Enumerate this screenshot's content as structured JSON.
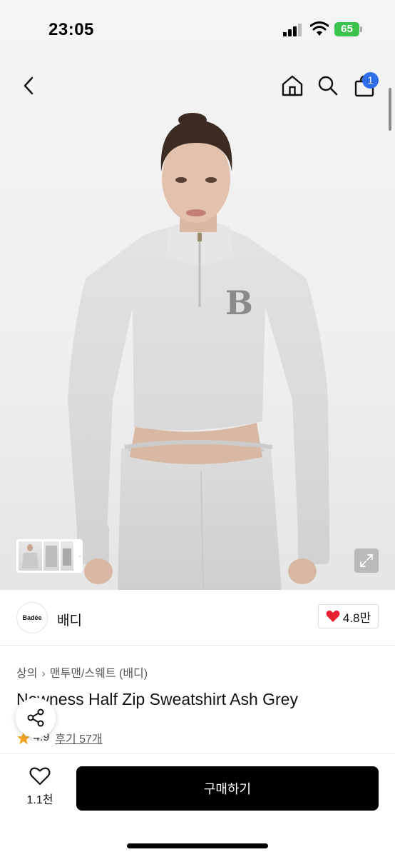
{
  "status_bar": {
    "time": "23:05",
    "battery": "65",
    "icons": [
      "signal-icon",
      "wifi-icon",
      "battery-icon"
    ]
  },
  "nav": {
    "icons": [
      "back-arrow-icon",
      "home-icon",
      "search-icon",
      "shopping-bag-icon"
    ],
    "cart_count": "1",
    "badge_color": "#2f6ee8"
  },
  "gallery": {
    "thumbnail_count": 3,
    "icons": [
      "chevron-right-icon",
      "expand-icon"
    ]
  },
  "brand": {
    "logo_text": "Badée",
    "name": "배디",
    "likes": "4.8만",
    "heart_color": "#e8202f"
  },
  "product": {
    "breadcrumb": [
      "상의",
      "맨투맨/스웨트 (배디)"
    ],
    "title": "Newness Half Zip Sweatshirt Ash Grey",
    "rating": "4.9",
    "review_link": "후기 57개",
    "star_color": "#f5a623"
  },
  "bottom_bar": {
    "wish_count": "1.1천",
    "buy_label": "구매하기",
    "buy_color": "#000000"
  }
}
